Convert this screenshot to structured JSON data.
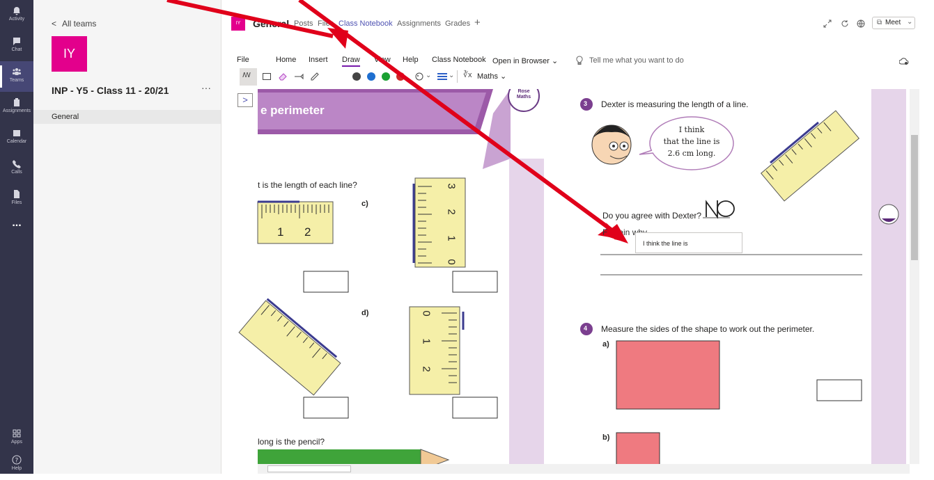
{
  "rail": {
    "items": [
      {
        "label": "Activity",
        "icon": "bell-icon"
      },
      {
        "label": "Chat",
        "icon": "chat-icon"
      },
      {
        "label": "Teams",
        "icon": "teams-icon"
      },
      {
        "label": "Assignments",
        "icon": "assignments-icon"
      },
      {
        "label": "Calendar",
        "icon": "calendar-icon"
      },
      {
        "label": "Calls",
        "icon": "phone-icon"
      },
      {
        "label": "Files",
        "icon": "files-icon"
      },
      {
        "label": "...",
        "icon": "more-icon"
      }
    ],
    "apps_label": "Apps",
    "help_label": "Help"
  },
  "teams_panel": {
    "back_label": "All teams",
    "team_avatar": "IY",
    "team_name": "INP - Y5 - Class 11 - 20/21",
    "more": "···",
    "channel": "General",
    "avatar_color": "#e3008c"
  },
  "header": {
    "badge": "IY",
    "channel": "General",
    "tabs": [
      "Posts",
      "Files",
      "Class Notebook",
      "Assignments",
      "Grades"
    ],
    "add": "+",
    "meet_label": "Meet",
    "active_tab_index": 2
  },
  "ribbon": {
    "tabs": [
      "File",
      "Home",
      "Insert",
      "Draw",
      "View",
      "Help",
      "Class Notebook"
    ],
    "active_tab": "Draw",
    "open_in_browser": "Open in Browser",
    "tell_me": "Tell me what you want to do",
    "maths_label": "Maths",
    "pen_colors": [
      "#444444",
      "#1f6fd0",
      "#1aa032",
      "#d02828"
    ]
  },
  "worksheet": {
    "banner_text": "e perimeter",
    "logo_text": "Rose Maths",
    "q_length": "t is the length of each line?",
    "label_c": "c)",
    "label_d": "d)",
    "ruler_a": [
      "1",
      "2"
    ],
    "ruler_c": [
      "3",
      "2",
      "1",
      "0"
    ],
    "ruler_d": [
      "0",
      "1",
      "2"
    ],
    "q_pencil": "long is the pencil?",
    "q3_num": "3",
    "q3_text": "Dexter is measuring the length of a line.",
    "bubble": [
      "I think",
      "that the line is",
      "2.6 cm long."
    ],
    "q3_agree": "Do you agree with Dexter?",
    "handwriting": "NO",
    "q3_explain": "Explain why.",
    "typed_note": "I think the line is",
    "q4_num": "4",
    "q4_text": "Measure the sides of the shape to work out the perimeter.",
    "label_a": "a)",
    "label_b": "b)",
    "shape_color": "#ef7a80",
    "purple": "#7b3f8f"
  }
}
